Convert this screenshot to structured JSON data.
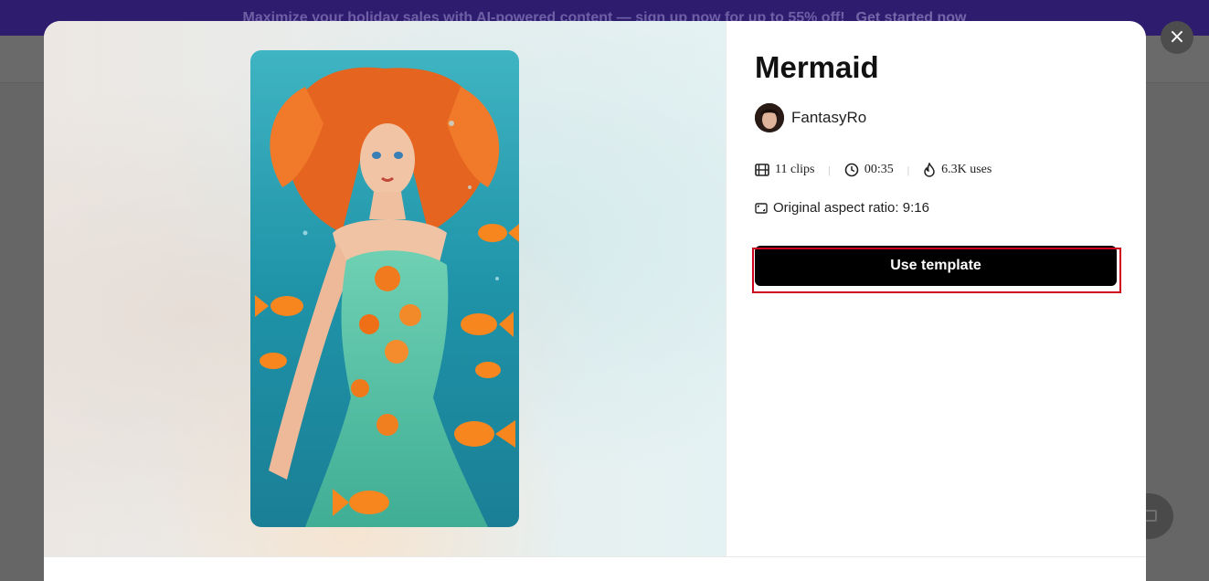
{
  "promo": {
    "text": "Maximize your holiday sales with AI-powered content — sign up now for up to 55% off!",
    "cta": "Get started now"
  },
  "modal": {
    "close_icon": "×",
    "template": {
      "title": "Mermaid",
      "author": "FantasyRo",
      "clips": "11 clips",
      "duration": "00:35",
      "uses": "6.3K uses",
      "aspect_ratio": "Original aspect ratio: 9:16",
      "use_button": "Use template"
    }
  },
  "icons": {
    "clips": "film-icon",
    "duration": "clock-icon",
    "uses": "flame-icon",
    "aspect": "aspect-ratio-icon",
    "close": "close-icon",
    "feedback": "feedback-icon"
  },
  "colors": {
    "promo_bg": "#2e1d6e",
    "button_bg": "#000000",
    "highlight": "#d0021b"
  }
}
